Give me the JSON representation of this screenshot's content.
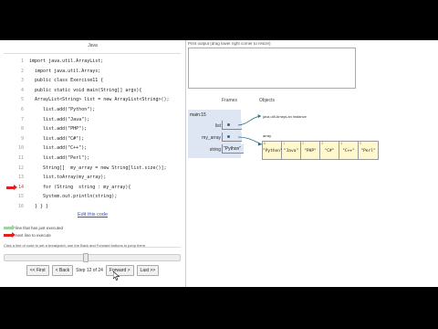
{
  "code": {
    "language": "Java",
    "lines": [
      {
        "num": "1",
        "text": "import java.util.ArrayList;"
      },
      {
        "num": "2",
        "text": "  import java.util.Arrays;"
      },
      {
        "num": "3",
        "text": "  public class Exercise11 {"
      },
      {
        "num": "4",
        "text": "  public static void main(String[] args){"
      },
      {
        "num": "5",
        "text": "  ArrayList<String> list = new ArrayList<String>();"
      },
      {
        "num": "6",
        "text": "     list.add(\"Python\");"
      },
      {
        "num": "7",
        "text": "     list.add(\"Java\");"
      },
      {
        "num": "8",
        "text": "     list.add(\"PHP\");"
      },
      {
        "num": "9",
        "text": "     list.add(\"C#\");"
      },
      {
        "num": "10",
        "text": "     list.add(\"C++\");"
      },
      {
        "num": "11",
        "text": "     list.add(\"Perl\");"
      },
      {
        "num": "12",
        "text": "     String[]  my_array = new String[list.size()];"
      },
      {
        "num": "13",
        "text": "     list.toArray(my_array);"
      },
      {
        "num": "14",
        "text": "     for (String  string : my_array){"
      },
      {
        "num": "15",
        "text": "     System.out.println(string);"
      },
      {
        "num": "16",
        "text": "  } } }"
      }
    ],
    "active_line_index": 13,
    "edit_link": "Edit this code"
  },
  "legend": {
    "executed": "line that has just executed",
    "next": "next line to execute"
  },
  "hint": "Click a line of code to set a breakpoint; use the Back and Forward buttons to jump there.",
  "navigation": {
    "first": "<< First",
    "back": "< Back",
    "step_label": "Step 12 of 24",
    "forward": "Forward >",
    "last": "Last >>",
    "progress": 0.46
  },
  "output": {
    "label": "Print output (drag lower right corner to resize)"
  },
  "viz": {
    "frames_header": "Frames",
    "objects_header": "Objects",
    "frame": {
      "name": "main:15",
      "vars": [
        {
          "name": "list",
          "value": ""
        },
        {
          "name": "my_array",
          "value": ""
        },
        {
          "name": "string",
          "value": "\"Python\""
        }
      ]
    },
    "iterator_label": "java.util.Arrays.an instance",
    "array_label": "array",
    "array": [
      {
        "idx": "0",
        "val": "\"Python\""
      },
      {
        "idx": "1",
        "val": "\"Java\""
      },
      {
        "idx": "2",
        "val": "\"PHP\""
      },
      {
        "idx": "3",
        "val": "\"C#\""
      },
      {
        "idx": "4",
        "val": "\"C++\""
      },
      {
        "idx": "5",
        "val": "\"Perl\""
      }
    ],
    "pointer_color": "#2a6f8a"
  },
  "colors": {
    "next_arrow": "#e02020",
    "executed_arrow": "#9fd49f",
    "frame_bg": "#dde6f2",
    "array_bg": "#fff8cc",
    "link": "#3355cc"
  }
}
